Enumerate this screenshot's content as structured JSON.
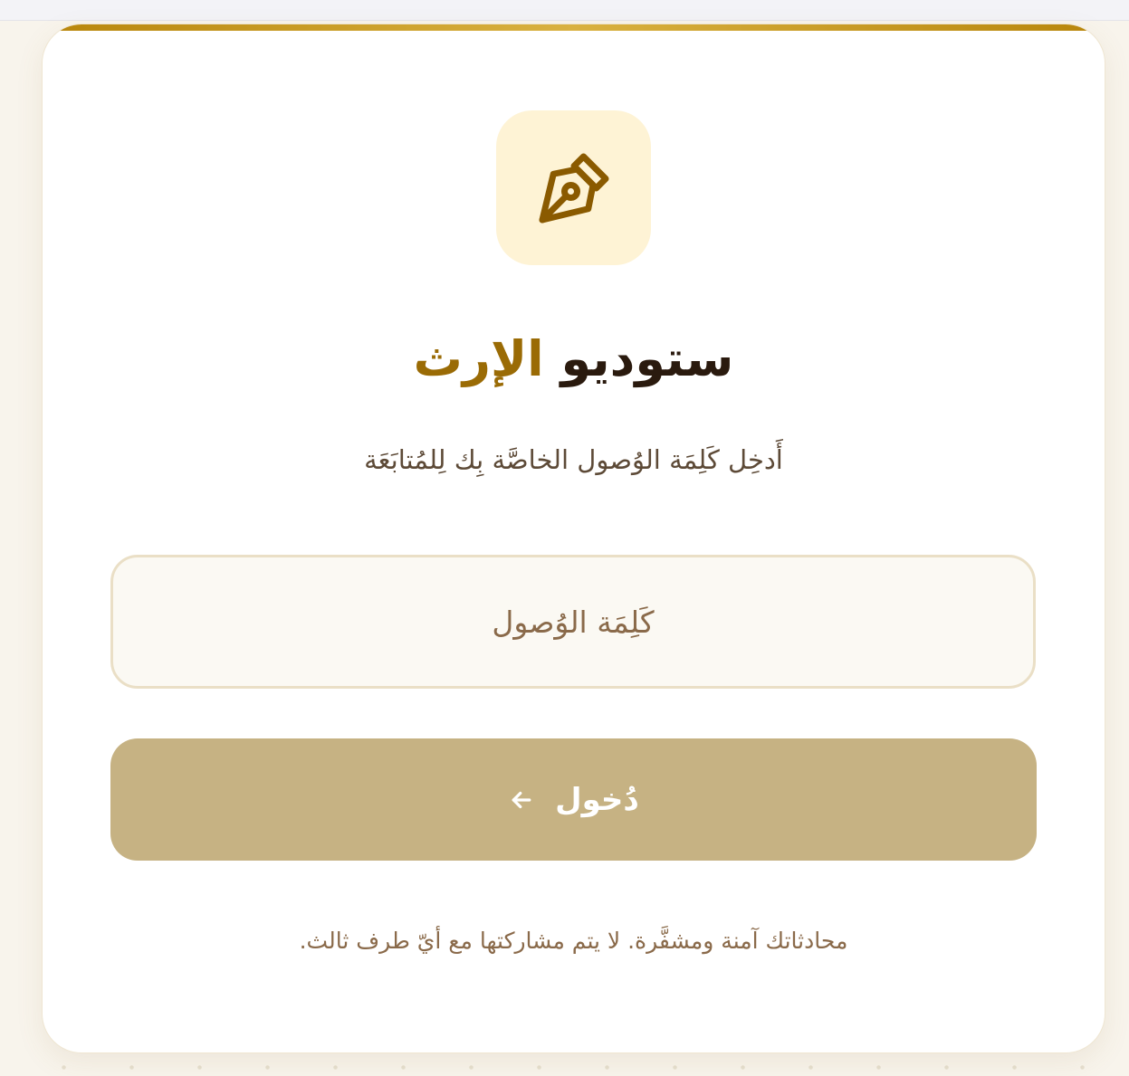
{
  "app": {
    "title_part1": "ستوديو",
    "title_part2": "الإرث",
    "logo_icon": "pen-nib-icon"
  },
  "login": {
    "subtitle": "أَدخِل كَلِمَة الوُصول الخاصَّة بِك لِلمُتابَعَة",
    "password_placeholder": "كَلِمَة الوُصول",
    "password_value": "",
    "submit_label": "دُخول",
    "submit_icon": "arrow-left-icon",
    "footnote": "محادثاتك آمنة ومشفَّرة. لا يتم مشاركتها مع أيّ طرف ثالث."
  },
  "colors": {
    "accent": "#9a6b05",
    "button": "#c6b283",
    "logo_bg": "#fef3d5",
    "page_bg": "#f8f4ec"
  }
}
